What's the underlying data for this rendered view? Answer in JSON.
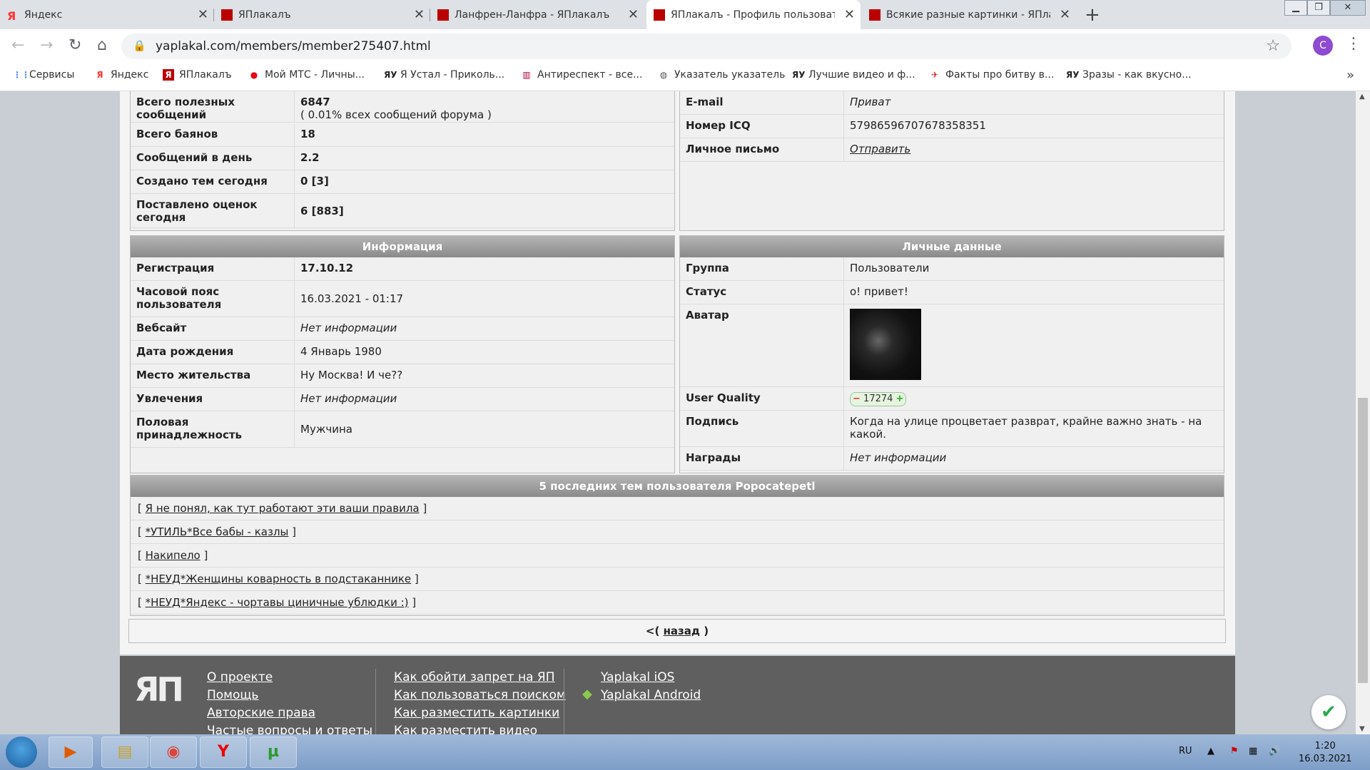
{
  "browser": {
    "tabs": [
      {
        "title": "Яндекс",
        "icon": "yandex-icon"
      },
      {
        "title": "ЯПлакалъ",
        "icon": "yaplakal-icon"
      },
      {
        "title": "Ланфрен-Ланфра - ЯПлакалъ",
        "icon": "yaplakal-icon"
      },
      {
        "title": "ЯПлакалъ - Профиль пользоват",
        "icon": "yaplakal-icon",
        "active": true
      },
      {
        "title": "Всякие разные картинки - ЯПла",
        "icon": "yaplakal-icon"
      }
    ],
    "url": "yaplakal.com/members/member275407.html",
    "profile_letter": "С",
    "bookmarks": [
      "Сервисы",
      "Яндекс",
      "ЯПлакалъ",
      "Мой МТС - Личны...",
      "Я Устал - Приколь...",
      "Антиреспект - все...",
      "Указатель указатель",
      "Лучшие видео и ф...",
      "Факты про битву в...",
      "Зразы - как вкусно..."
    ]
  },
  "stats": {
    "rows": [
      {
        "k": "Всего полезных сообщений",
        "v": "6847",
        "sub": "( 0.01% всех сообщений форума )"
      },
      {
        "k": "Всего баянов",
        "v": "18"
      },
      {
        "k": "Сообщений в день",
        "v": "2.2"
      },
      {
        "k": "Создано тем сегодня",
        "v": "0 [3]"
      },
      {
        "k": "Поставлено оценок сегодня",
        "v": "6 [883]"
      }
    ]
  },
  "contacts": {
    "rows": [
      {
        "k": "E-mail",
        "v": "Приват"
      },
      {
        "k": "Номер ICQ",
        "v": "57986596707678358351"
      },
      {
        "k": "Личное письмо",
        "v": "Отправить"
      }
    ]
  },
  "info": {
    "title": "Информация",
    "rows": [
      {
        "k": "Регистрация",
        "v": "17.10.12"
      },
      {
        "k": "Часовой пояс пользователя",
        "v": "16.03.2021 - 01:17"
      },
      {
        "k": "Вебсайт",
        "v": "Нет информации"
      },
      {
        "k": "Дата рождения",
        "v": "4 Январь 1980"
      },
      {
        "k": "Место жительства",
        "v": "Ну Москва! И че??"
      },
      {
        "k": "Увлечения",
        "v": "Нет информации"
      },
      {
        "k": "Половая принадлежность",
        "v": "Мужчина"
      }
    ]
  },
  "personal": {
    "title": "Личные данные",
    "group_k": "Группа",
    "group_v": "Пользователи",
    "status_k": "Статус",
    "status_v": "о! привет!",
    "avatar_k": "Аватар",
    "uq_k": "User Quality",
    "uq_v": "17274",
    "sig_k": "Подпись",
    "sig_v": "Когда на улице процветает разврат, крайне важно знать - на какой.",
    "awards_k": "Награды",
    "awards_v": "Нет информации"
  },
  "topics": {
    "title": "5 последних тем пользователя Popocatepetl",
    "items": [
      "Я не понял, как тут работают эти ваши правила",
      "*УТИЛЬ*Все бабы - казлы",
      "Накипело",
      "*НЕУД*Женщины коварность в подстаканнике",
      "*НЕУД*Яндекс - чортавы циничные ублюдки :)"
    ]
  },
  "back": {
    "prefix": "<(",
    "link": "назад",
    "suffix": ")"
  },
  "footer": {
    "col1": [
      "О проекте",
      "Помощь",
      "Авторские права",
      "Частые вопросы и ответы"
    ],
    "col2": [
      "Как обойти запрет на ЯП",
      "Как пользоваться поиском",
      "Как разместить картинки",
      "Как разместить видео"
    ],
    "col3": [
      "Yaplakal iOS",
      "Yaplakal Android"
    ]
  },
  "taskbar": {
    "lang": "RU",
    "time": "1:20",
    "date": "16.03.2021"
  }
}
